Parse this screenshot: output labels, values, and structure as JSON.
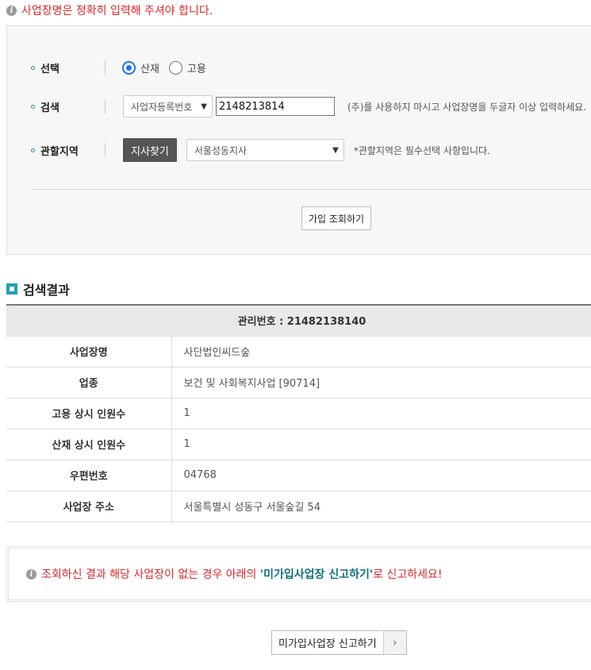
{
  "notice": {
    "text": "사업장명은 정확히 입력해 주셔야 합니다."
  },
  "search": {
    "choice_label": "선택",
    "options": [
      "산재",
      "고용"
    ],
    "selected_option": "산재",
    "search_label": "검색",
    "search_type": "사업자등록번호",
    "search_value": "2148213814",
    "search_hint": "(주)를 사용하지 마시고 사업장명을 두글자 이상 입력하세요.",
    "region_label": "관할지역",
    "find_branch_button": "지사찾기",
    "region_value": "서울성동지사",
    "region_hint": "*관할지역은 필수선택 사항입니다.",
    "submit_button": "가입 조회하기"
  },
  "results": {
    "title": "검색결과",
    "header": "관리번호 : 21482138140",
    "rows": [
      {
        "label": "사업장명",
        "value": "사단법인씨드숲"
      },
      {
        "label": "업종",
        "value": "보건 및 사회복지사업 [90714]"
      },
      {
        "label": "고용 상시 인원수",
        "value": "1"
      },
      {
        "label": "산재 상시 인원수",
        "value": "1"
      },
      {
        "label": "우편번호",
        "value": "04768"
      },
      {
        "label": "사업장 주소",
        "value": "서울특별시 성동구 서울숲길 54"
      }
    ]
  },
  "warning": {
    "prefix": "조회하신 결과 해당 사업장이 없는 경우 아래의 ",
    "highlight": "'미가입사업장 신고하기'",
    "suffix": "로 신고하세요!"
  },
  "report_button": {
    "label": "미가입사업장 신고하기",
    "arrow": "›"
  },
  "colors": {
    "alert": "#e0262c",
    "accent": "#1b9fb5",
    "highlight": "#11707a"
  }
}
